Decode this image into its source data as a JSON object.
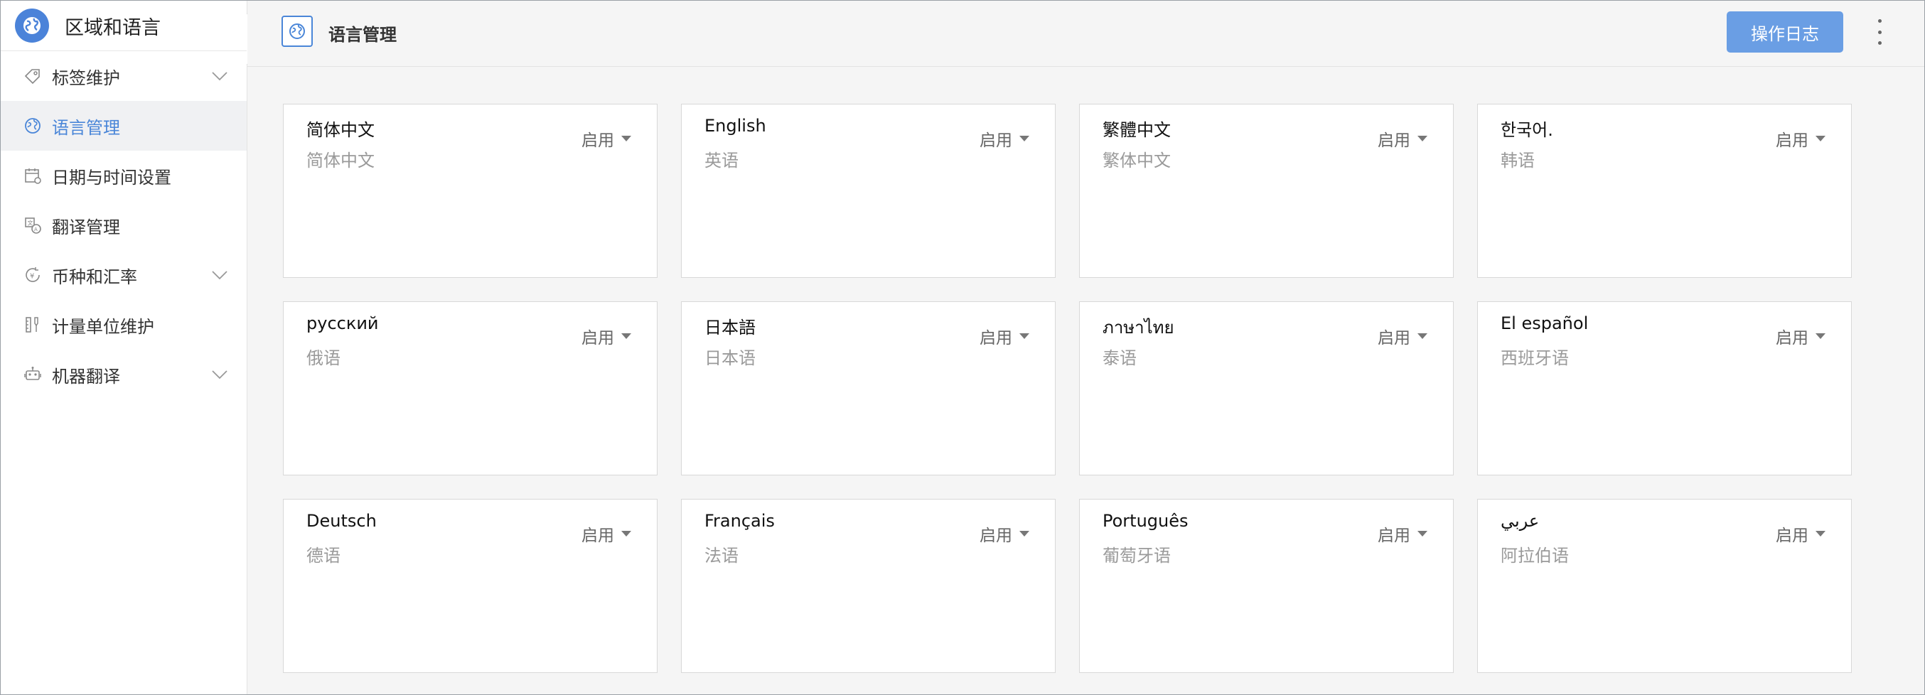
{
  "sidebar": {
    "title": "区域和语言",
    "logo_icon": "globe-icon",
    "items": [
      {
        "label": "标签维护",
        "icon": "tag-icon",
        "expandable": true,
        "active": false
      },
      {
        "label": "语言管理",
        "icon": "globe-icon",
        "expandable": false,
        "active": true
      },
      {
        "label": "日期与时间设置",
        "icon": "calendar-clock-icon",
        "expandable": false,
        "active": false
      },
      {
        "label": "翻译管理",
        "icon": "translate-icon",
        "expandable": false,
        "active": false
      },
      {
        "label": "币种和汇率",
        "icon": "currency-icon",
        "expandable": true,
        "active": false
      },
      {
        "label": "计量单位维护",
        "icon": "measure-icon",
        "expandable": false,
        "active": false
      },
      {
        "label": "机器翻译",
        "icon": "robot-icon",
        "expandable": true,
        "active": false
      }
    ]
  },
  "header": {
    "title": "语言管理",
    "log_button": "操作日志"
  },
  "colors": {
    "accent": "#4a86d8",
    "button": "#6a9ee4",
    "active_bg": "#f0f1f3"
  },
  "languages": [
    {
      "name": "简体中文",
      "sub": "简体中文",
      "status": "启用"
    },
    {
      "name": "English",
      "sub": "英语",
      "status": "启用"
    },
    {
      "name": "繁體中文",
      "sub": "繁体中文",
      "status": "启用"
    },
    {
      "name": "한국어.",
      "sub": "韩语",
      "status": "启用"
    },
    {
      "name": "русский",
      "sub": "俄语",
      "status": "启用"
    },
    {
      "name": "日本語",
      "sub": "日本语",
      "status": "启用"
    },
    {
      "name": "ภาษาไทย",
      "sub": "泰语",
      "status": "启用"
    },
    {
      "name": "El español",
      "sub": "西班牙语",
      "status": "启用"
    },
    {
      "name": "Deutsch",
      "sub": "德语",
      "status": "启用"
    },
    {
      "name": "Français",
      "sub": "法语",
      "status": "启用"
    },
    {
      "name": "Português",
      "sub": "葡萄牙语",
      "status": "启用"
    },
    {
      "name": "عربي",
      "sub": "阿拉伯语",
      "status": "启用"
    }
  ]
}
